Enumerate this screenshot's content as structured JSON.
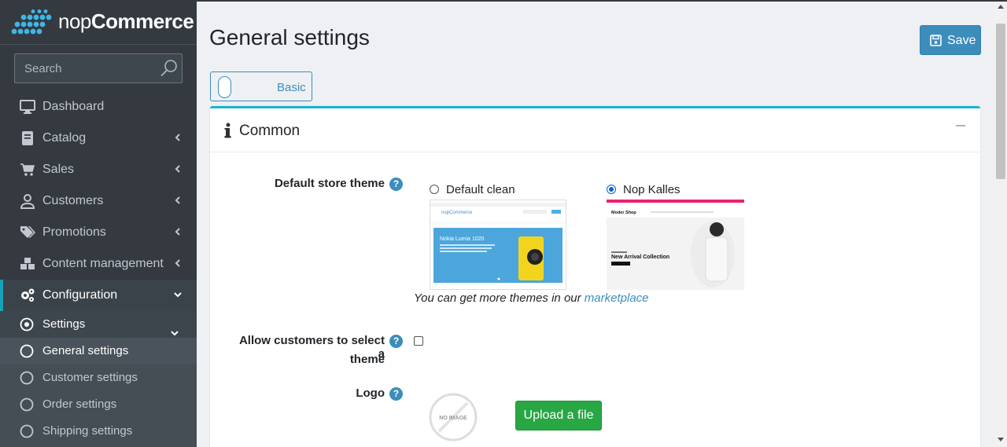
{
  "brand": {
    "name_light": "nop",
    "name_bold": "Commerce"
  },
  "search": {
    "placeholder": "Search"
  },
  "sidebar": {
    "items": [
      {
        "label": "Dashboard",
        "icon": "monitor-icon"
      },
      {
        "label": "Catalog",
        "icon": "book-icon"
      },
      {
        "label": "Sales",
        "icon": "cart-icon"
      },
      {
        "label": "Customers",
        "icon": "user-icon"
      },
      {
        "label": "Promotions",
        "icon": "tags-icon"
      },
      {
        "label": "Content management",
        "icon": "cubes-icon"
      },
      {
        "label": "Configuration",
        "icon": "gears-icon"
      }
    ],
    "sub_items": [
      {
        "label": "Settings"
      },
      {
        "label": "General settings"
      },
      {
        "label": "Customer settings"
      },
      {
        "label": "Order settings"
      },
      {
        "label": "Shipping settings"
      }
    ]
  },
  "page": {
    "title": "General settings",
    "save_label": "Save",
    "mode_label": "Basic"
  },
  "card": {
    "title": "Common"
  },
  "form": {
    "default_theme_label": "Default store theme",
    "themes": [
      {
        "name": "Default clean",
        "selected": false
      },
      {
        "name": "Nop Kalles",
        "selected": true
      }
    ],
    "thumb_default": {
      "brand": "nopCommerce",
      "headline": "Nokia Lumia 1020"
    },
    "thumb_kalles": {
      "shop": "Moder Shop",
      "headline": "New Arrival Collection"
    },
    "marketplace_prefix": "You can get more themes in our ",
    "marketplace_link": "marketplace",
    "allow_select_label_1": "Allow customers to select a",
    "allow_select_label_2": "theme",
    "logo_label": "Logo",
    "no_image_text": "NO IMAGE",
    "upload_label": "Upload a file",
    "help_glyph": "?"
  },
  "colors": {
    "sidebar_bg": "#343a40",
    "accent": "#3c8dbc",
    "card_border_top": "#17b4d3",
    "upload_green": "#28a745"
  }
}
